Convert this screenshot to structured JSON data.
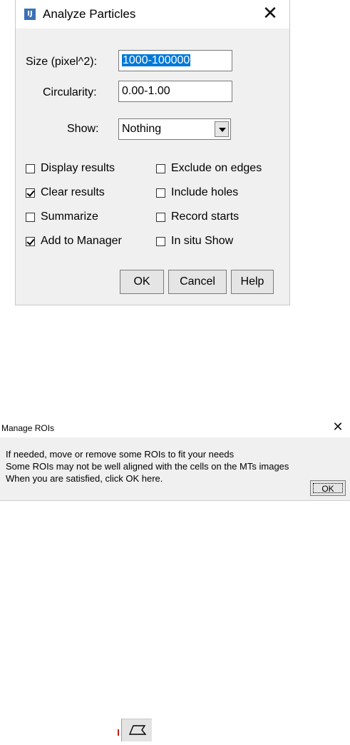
{
  "analyze_particles": {
    "title": "Analyze Particles",
    "icon": "imagej-icon",
    "close_glyph": "✕",
    "size_label": "Size (pixel^2):",
    "size_value": "1000-100000",
    "circularity_label": "Circularity:",
    "circularity_value": "0.00-1.00",
    "show_label": "Show:",
    "show_value": "Nothing",
    "checkboxes": [
      {
        "label": "Display results",
        "checked": false
      },
      {
        "label": "Clear results",
        "checked": true
      },
      {
        "label": "Summarize",
        "checked": false
      },
      {
        "label": "Add to Manager",
        "checked": true
      },
      {
        "label": "Exclude on edges",
        "checked": false
      },
      {
        "label": "Include holes",
        "checked": false
      },
      {
        "label": "Record starts",
        "checked": false
      },
      {
        "label": "In situ Show",
        "checked": false
      }
    ],
    "buttons": {
      "ok": "OK",
      "cancel": "Cancel",
      "help": "Help"
    }
  },
  "manage_rois": {
    "title": "Manage ROIs",
    "close_glyph": "✕",
    "lines": [
      "If needed, move or remove some ROIs to fit your needs",
      "Some ROIs may not be well aligned with the cells on the MTs images",
      "When you are satisfied, click OK here."
    ],
    "ok_label": "OK"
  },
  "toolbar_fragment": {
    "icon": "freehand-selection-icon"
  }
}
